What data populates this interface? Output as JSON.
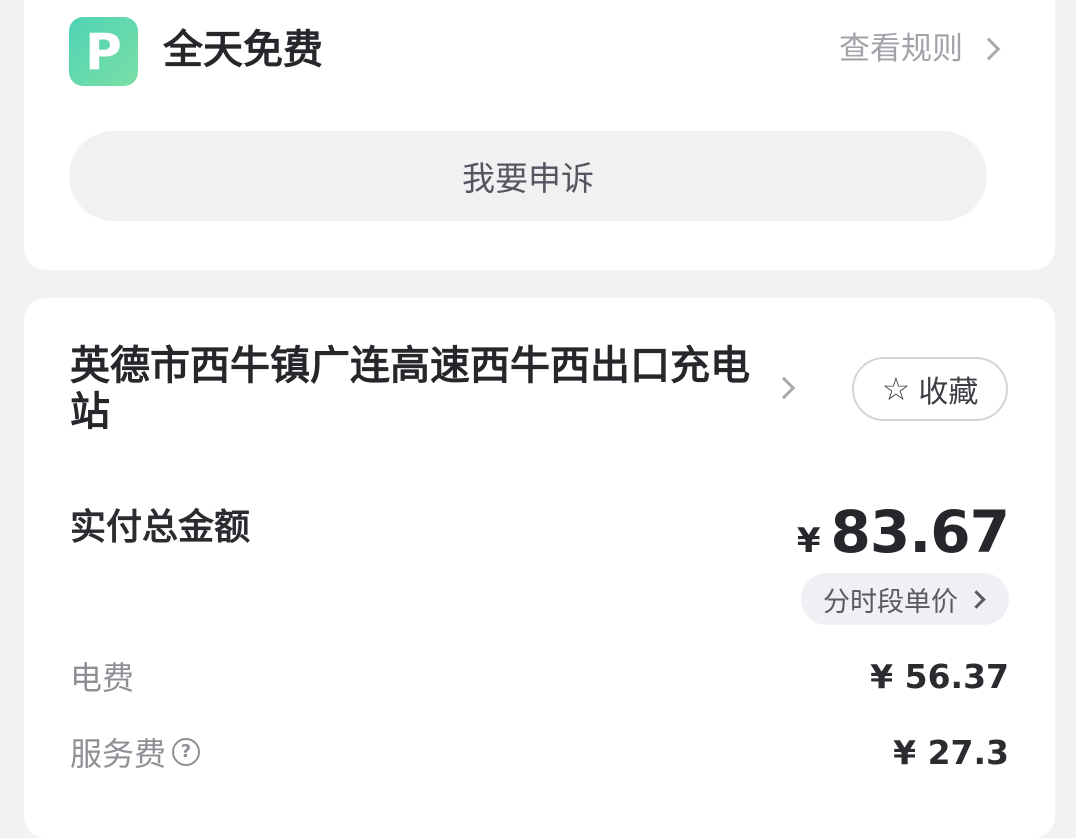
{
  "parking": {
    "logo_letter": "P",
    "title": "全天免费",
    "rules_link": "查看规则"
  },
  "appeal_button": "我要申诉",
  "station": {
    "name": "英德市西牛镇广连高速西牛西出口充电站",
    "favorite_label": "收藏"
  },
  "payment": {
    "total_label": "实付总金额",
    "currency": "¥",
    "total_amount": "83.67",
    "time_of_use_price_label": "分时段单价"
  },
  "fees": {
    "electricity": {
      "label": "电费",
      "value": "¥ 56.37"
    },
    "service": {
      "label": "服务费",
      "value": "¥ 27.3"
    }
  }
}
